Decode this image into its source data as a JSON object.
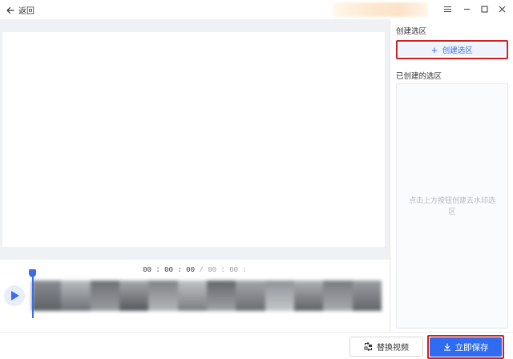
{
  "titlebar": {
    "back_label": "返回",
    "icons": [
      "arrow-left-icon",
      "menu-icon",
      "minimize-icon",
      "maximize-icon",
      "close-icon"
    ]
  },
  "right_panel": {
    "create_section_title": "创建选区",
    "create_button_label": "创建选区",
    "created_section_title": "已创建的选区",
    "empty_hint": "点击上方按钮创建去水印选区"
  },
  "timeline": {
    "current_time": "00 : 00 : 00",
    "separator": "/",
    "total_time": "00 : 00 :"
  },
  "bottombar": {
    "replace_button_label": "替换视频",
    "save_button_label": "立即保存"
  },
  "colors": {
    "accent": "#2f6cf2",
    "highlight_border": "#d21f1f",
    "panel_bg": "#f0f1f4"
  }
}
